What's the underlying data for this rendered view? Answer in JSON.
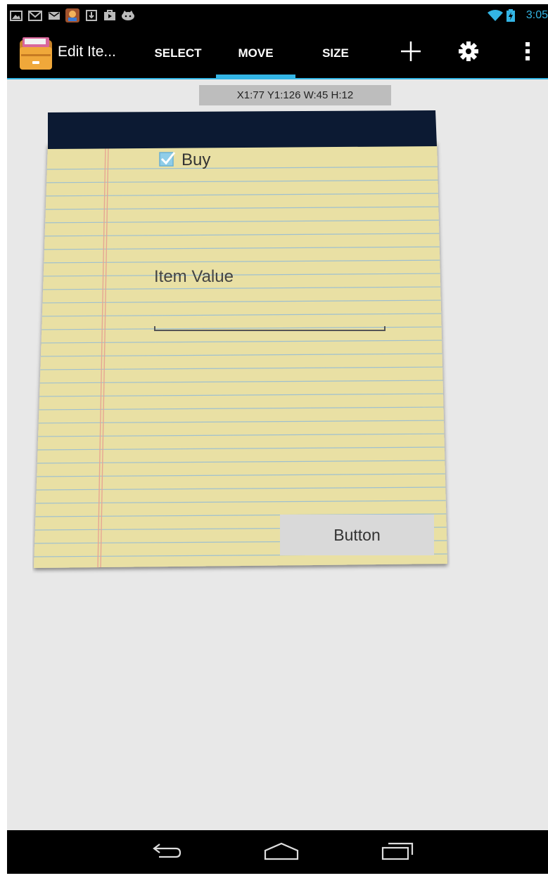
{
  "status_bar": {
    "time": "3:05",
    "notification_icons": [
      "gallery-icon",
      "gmail-icon",
      "email-icon",
      "game-icon",
      "download-icon",
      "play-store-icon",
      "cat-icon"
    ],
    "status_icons": [
      "wifi-icon",
      "battery-charging-icon"
    ],
    "accent_color": "#33b5e5"
  },
  "action_bar": {
    "app_icon": "drawer-app-icon",
    "title": "Edit Ite...",
    "tabs": [
      {
        "label": "SELECT",
        "selected": false
      },
      {
        "label": "MOVE",
        "selected": true
      },
      {
        "label": "SIZE",
        "selected": false
      }
    ],
    "actions": [
      "add-icon",
      "settings-icon",
      "overflow-menu-icon"
    ]
  },
  "info_bar": {
    "text": "X1:77 Y1:126 W:45 H:12"
  },
  "notepad": {
    "checkbox_label": "Buy",
    "checkbox_checked": true,
    "field_label": "Item Value",
    "field_value": "",
    "button_label": "Button",
    "header_color": "#0c1a33",
    "paper_color": "#e9e0a4"
  },
  "nav_bar": {
    "buttons": [
      "back-icon",
      "home-icon",
      "recent-apps-icon"
    ]
  }
}
